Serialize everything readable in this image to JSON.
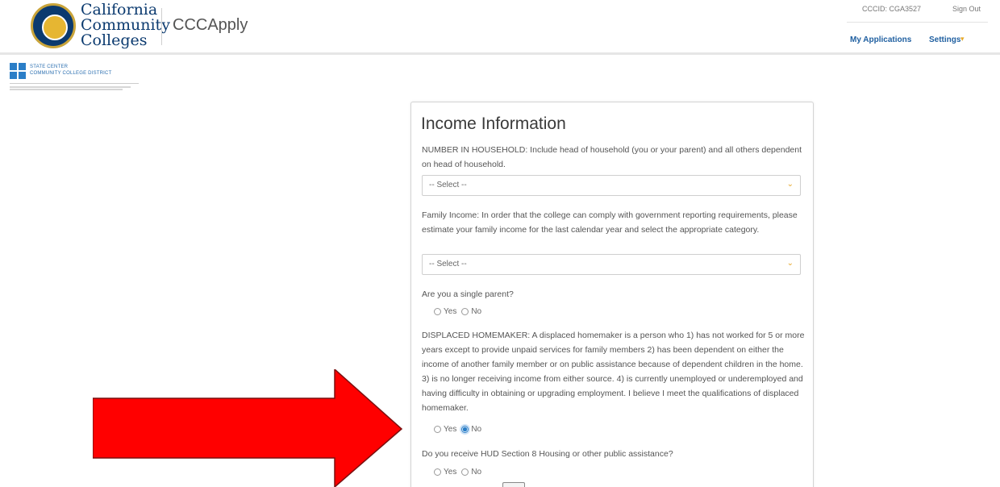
{
  "header": {
    "logo_line1": "California",
    "logo_line2": "Community",
    "logo_line3": "Colleges",
    "app_name": "CCCApply",
    "ccc_id": "CCCID: CGA3527",
    "sign_out": "Sign Out",
    "nav_my_applications": "My Applications",
    "nav_settings": "Settings"
  },
  "district": {
    "name_line1": "STATE CENTER",
    "name_line2": "COMMUNITY COLLEGE DISTRICT"
  },
  "form": {
    "title": "Income Information",
    "household_label": "NUMBER IN HOUSEHOLD: Include head of household (you or your parent) and all others dependent on head of household.",
    "household_select": "-- Select --",
    "income_label": "Family Income: In order that the college can comply with government reporting requirements, please estimate your family income for the last calendar year and select the appropriate category.",
    "income_select": "-- Select --",
    "single_parent_label": "Are you a single parent?",
    "displaced_label": "DISPLACED HOMEMAKER: A displaced homemaker is a person who 1) has not worked for 5 or more years except to provide unpaid services for family members 2) has been dependent on either the income of another family member or on public assistance because of dependent children in the home. 3) is no longer receiving income from either source. 4) is currently unemployed or underemployed and having difficulty in obtaining or upgrading employment. I believe I meet the qualifications of displaced homemaker.",
    "hud_label": "Do you receive HUD Section 8 Housing or other public assistance?",
    "yes": "Yes",
    "no": "No"
  },
  "colors": {
    "accent_blue": "#1f5fa0",
    "chevron_gold": "#e6a82a",
    "arrow_red": "#ff0000"
  }
}
